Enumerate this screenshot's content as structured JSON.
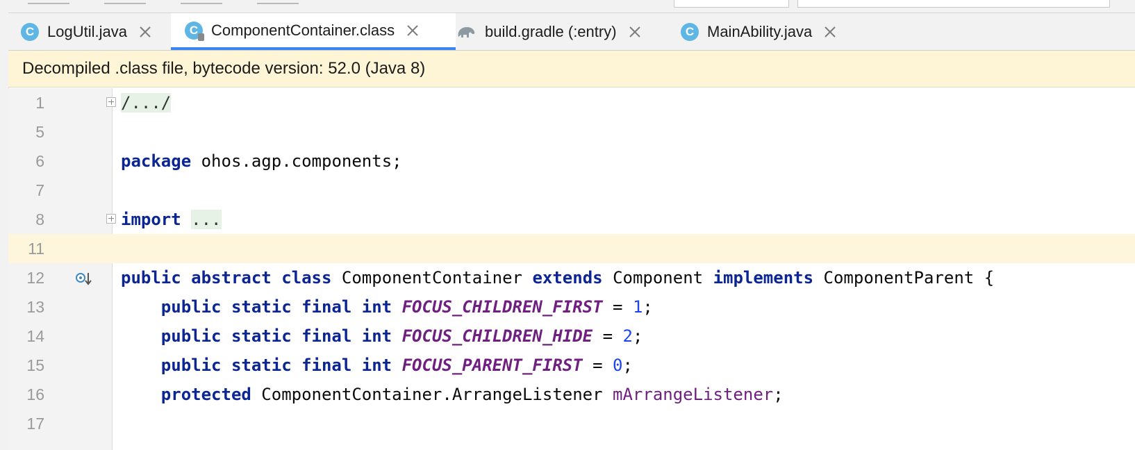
{
  "tabs": [
    {
      "label": "LogUtil.java",
      "icon": "class-icon",
      "active": false
    },
    {
      "label": "ComponentContainer.class",
      "icon": "class-readonly-icon",
      "active": true
    },
    {
      "label": "build.gradle (:entry)",
      "icon": "gradle-icon",
      "active": false
    },
    {
      "label": "MainAbility.java",
      "icon": "class-icon",
      "active": false
    }
  ],
  "class_icon_letter": "C",
  "banner": {
    "text": "Decompiled .class file, bytecode version: 52.0 (Java 8)"
  },
  "lines": [
    {
      "num": "1"
    },
    {
      "num": "5"
    },
    {
      "num": "6"
    },
    {
      "num": "7"
    },
    {
      "num": "8"
    },
    {
      "num": "11"
    },
    {
      "num": "12"
    },
    {
      "num": "13"
    },
    {
      "num": "14"
    },
    {
      "num": "15"
    },
    {
      "num": "16"
    },
    {
      "num": "17"
    }
  ],
  "code": {
    "l1_fold": "/.../",
    "l6_kw": "package",
    "l6_rest": " ohos.agp.components;",
    "l8_kw": "import",
    "l8_fold": "...",
    "l12": {
      "k1": "public",
      "k2": "abstract",
      "k3": "class",
      "name": "ComponentContainer",
      "k4": "extends",
      "parent": "Component",
      "k5": "implements",
      "iface": "ComponentParent",
      "brace": "{"
    },
    "l13": {
      "mods": "public static final int",
      "name": "FOCUS_CHILDREN_FIRST",
      "eq": " = ",
      "val": "1",
      "semi": ";"
    },
    "l14": {
      "mods": "public static final int",
      "name": "FOCUS_CHILDREN_HIDE",
      "eq": " = ",
      "val": "2",
      "semi": ";"
    },
    "l15": {
      "mods": "public static final int",
      "name": "FOCUS_PARENT_FIRST",
      "eq": " = ",
      "val": "0",
      "semi": ";"
    },
    "l16": {
      "mod": "protected",
      "type": "ComponentContainer.ArrangeListener",
      "name": "mArrangeListener",
      "semi": ";"
    }
  },
  "colors": {
    "keyword": "#0b2593",
    "constant": "#6f1f7f",
    "number": "#1c44ee",
    "active_tab_underline": "#3d85f1",
    "banner_bg": "#fdf5d5"
  }
}
